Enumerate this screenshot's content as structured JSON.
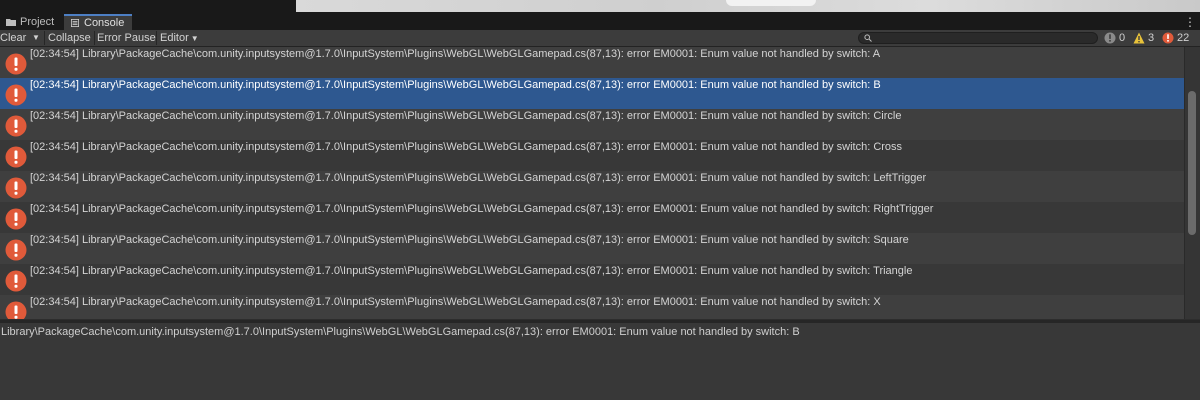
{
  "tabs": [
    {
      "label": "Project",
      "icon": "folder-icon",
      "active": false
    },
    {
      "label": "Console",
      "icon": "console-icon",
      "active": true
    }
  ],
  "toolbar": {
    "clear_label": "Clear",
    "collapse_label": "Collapse",
    "error_pause_label": "Error Pause",
    "editor_label": "Editor",
    "search_placeholder": "",
    "counts": {
      "info": "0",
      "warning": "3",
      "error": "22"
    }
  },
  "colors": {
    "accent": "#4d7fc4",
    "selected_row": "#2e5890",
    "error_icon": "#e05a3a",
    "warning_icon": "#e8c23a"
  },
  "logs": [
    {
      "text": "[02:34:54] Library\\PackageCache\\com.unity.inputsystem@1.7.0\\InputSystem\\Plugins\\WebGL\\WebGLGamepad.cs(87,13): error EM0001: Enum value not handled by switch: A",
      "selected": false
    },
    {
      "text": "[02:34:54] Library\\PackageCache\\com.unity.inputsystem@1.7.0\\InputSystem\\Plugins\\WebGL\\WebGLGamepad.cs(87,13): error EM0001: Enum value not handled by switch: B",
      "selected": true
    },
    {
      "text": "[02:34:54] Library\\PackageCache\\com.unity.inputsystem@1.7.0\\InputSystem\\Plugins\\WebGL\\WebGLGamepad.cs(87,13): error EM0001: Enum value not handled by switch: Circle",
      "selected": false
    },
    {
      "text": "[02:34:54] Library\\PackageCache\\com.unity.inputsystem@1.7.0\\InputSystem\\Plugins\\WebGL\\WebGLGamepad.cs(87,13): error EM0001: Enum value not handled by switch: Cross",
      "selected": false
    },
    {
      "text": "[02:34:54] Library\\PackageCache\\com.unity.inputsystem@1.7.0\\InputSystem\\Plugins\\WebGL\\WebGLGamepad.cs(87,13): error EM0001: Enum value not handled by switch: LeftTrigger",
      "selected": false
    },
    {
      "text": "[02:34:54] Library\\PackageCache\\com.unity.inputsystem@1.7.0\\InputSystem\\Plugins\\WebGL\\WebGLGamepad.cs(87,13): error EM0001: Enum value not handled by switch: RightTrigger",
      "selected": false
    },
    {
      "text": "[02:34:54] Library\\PackageCache\\com.unity.inputsystem@1.7.0\\InputSystem\\Plugins\\WebGL\\WebGLGamepad.cs(87,13): error EM0001: Enum value not handled by switch: Square",
      "selected": false
    },
    {
      "text": "[02:34:54] Library\\PackageCache\\com.unity.inputsystem@1.7.0\\InputSystem\\Plugins\\WebGL\\WebGLGamepad.cs(87,13): error EM0001: Enum value not handled by switch: Triangle",
      "selected": false
    },
    {
      "text": "[02:34:54] Library\\PackageCache\\com.unity.inputsystem@1.7.0\\InputSystem\\Plugins\\WebGL\\WebGLGamepad.cs(87,13): error EM0001: Enum value not handled by switch: X",
      "selected": false
    }
  ],
  "detail": {
    "text": "Library\\PackageCache\\com.unity.inputsystem@1.7.0\\InputSystem\\Plugins\\WebGL\\WebGLGamepad.cs(87,13): error EM0001: Enum value not handled by switch: B"
  }
}
